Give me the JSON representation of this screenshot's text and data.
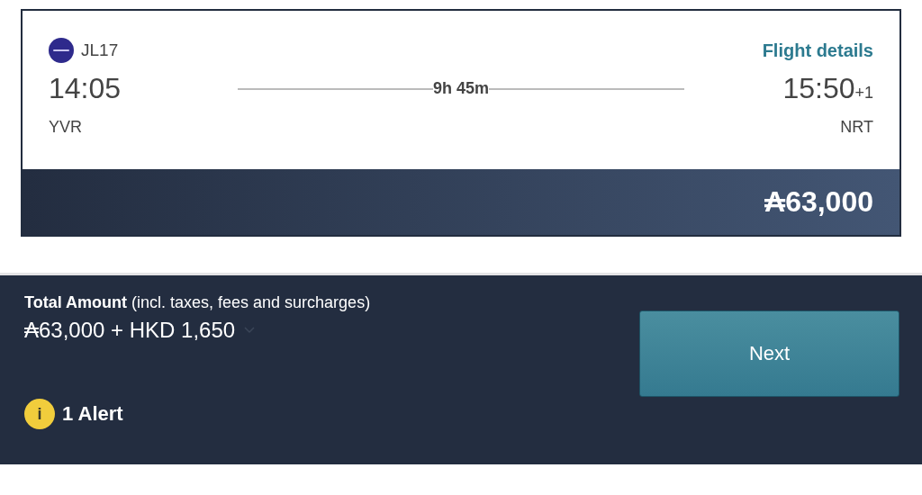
{
  "flight": {
    "number": "JL17",
    "details_link": "Flight details",
    "departure": {
      "time": "14:05",
      "airport": "YVR"
    },
    "duration": "9h 45m",
    "arrival": {
      "time": "15:50",
      "day_offset": "+1",
      "airport": "NRT"
    },
    "price": "₳63,000"
  },
  "summary": {
    "label": "Total Amount",
    "note": "(incl. taxes, fees and surcharges)",
    "total": "₳63,000 + HKD 1,650",
    "next_button": "Next",
    "alert_icon": "i",
    "alert": "1 Alert"
  }
}
